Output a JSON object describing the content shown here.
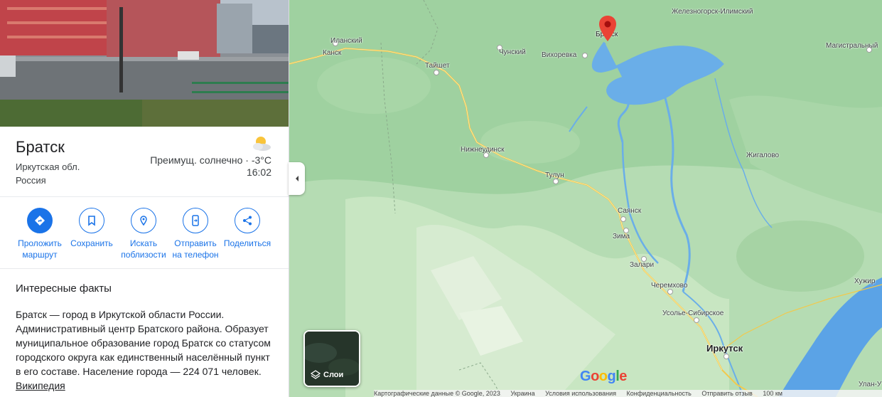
{
  "place": {
    "name": "Братск",
    "region": "Иркутская обл.",
    "country": "Россия"
  },
  "weather": {
    "description": "Преимущ. солнечно · -3°C",
    "time": "16:02",
    "icon": "partly-sunny-icon"
  },
  "actions": [
    {
      "label1": "Проложить",
      "label2": "маршрут",
      "icon": "directions-icon"
    },
    {
      "label1": "Сохранить",
      "label2": "",
      "icon": "bookmark-icon"
    },
    {
      "label1": "Искать",
      "label2": "поблизости",
      "icon": "nearby-icon"
    },
    {
      "label1": "Отправить",
      "label2": "на телефон",
      "icon": "send-to-phone-icon"
    },
    {
      "label1": "Поделиться",
      "label2": "",
      "icon": "share-icon"
    }
  ],
  "facts": {
    "title": "Интересные факты",
    "text": "Братск — город в Иркутской области России. Административный центр Братского района. Образует муниципальное образование город Братск со статусом городского округа как единственный населённый пункт в его составе. Население города — 224 071 человек.",
    "link": "Википедия"
  },
  "map": {
    "cities": [
      {
        "name": "Железногорск-Илимский"
      },
      {
        "name": "Братск"
      },
      {
        "name": "Иланский"
      },
      {
        "name": "Канск"
      },
      {
        "name": "Чунский"
      },
      {
        "name": "Вихоревка"
      },
      {
        "name": "Магистральный"
      },
      {
        "name": "Тайшет"
      },
      {
        "name": "Нижнеудинск"
      },
      {
        "name": "Жигалово"
      },
      {
        "name": "Тулун"
      },
      {
        "name": "Саянск"
      },
      {
        "name": "Зима"
      },
      {
        "name": "Залари"
      },
      {
        "name": "Черемхово"
      },
      {
        "name": "Хужир"
      },
      {
        "name": "Усолье-Сибирское"
      },
      {
        "name": "Иркутск"
      },
      {
        "name": "Улан-У"
      }
    ],
    "layers_label": "Слои",
    "logo": "Google",
    "footer": [
      "Картографические данные © Google, 2023",
      "Украина",
      "Условия использования",
      "Конфиденциальность",
      "Отправить отзыв",
      "100 км"
    ]
  },
  "colors": {
    "accent": "#1a73e8",
    "land": "#b5dcb3",
    "water": "#5ba3e6",
    "road": "#f2c94c",
    "pin": "#ea4335"
  }
}
